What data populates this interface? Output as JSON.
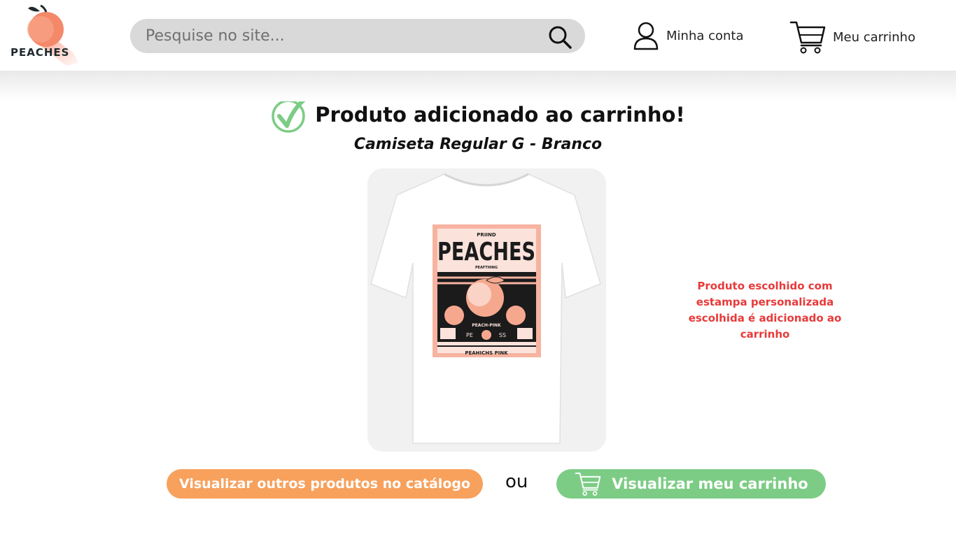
{
  "header": {
    "logo_text": "PEACHES",
    "search": {
      "placeholder": "Pesquise no site..."
    },
    "account_label": "Minha conta",
    "cart_label": "Meu carrinho"
  },
  "confirmation": {
    "title": "Produto adicionado ao carrinho!",
    "product_name": "Camiseta Regular G - Branco"
  },
  "product": {
    "print_texts": [
      "PRIIND",
      "PEACHES",
      "PEAFTHING",
      "PEACH-PINK",
      "PE",
      "SS",
      "PEAHICHS PINK"
    ]
  },
  "note": "Produto escolhido com estampa personalizada escolhida é adicionado ao carrinho",
  "actions": {
    "catalog_button": "Visualizar outros produtos no catálogo",
    "separator": "ou",
    "cart_button": "Visualizar meu carrinho"
  },
  "colors": {
    "peach": "#f7a15d",
    "green": "#7ccc85",
    "note_red": "#e83a3a",
    "search_bg": "#d9d9d9"
  },
  "icons": [
    "peach-logo-icon",
    "search-icon",
    "user-icon",
    "cart-icon",
    "check-icon",
    "cart-button-icon"
  ]
}
